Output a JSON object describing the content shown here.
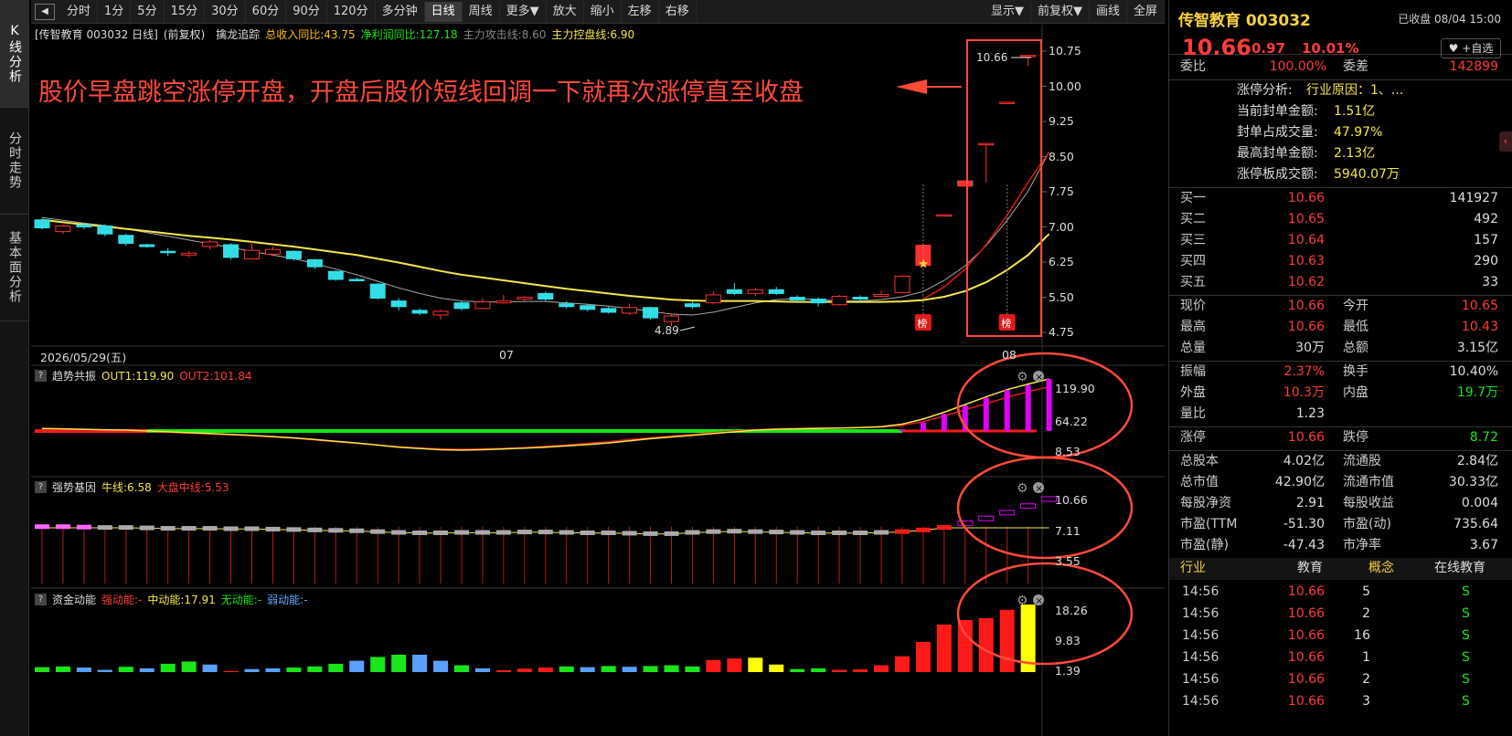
{
  "toolbar": {
    "periods": [
      "分时",
      "1分",
      "5分",
      "15分",
      "30分",
      "60分",
      "90分",
      "120分",
      "多分钟",
      "日线",
      "周线",
      "更多▼",
      "放大",
      "缩小",
      "左移",
      "右移"
    ],
    "active": "日线",
    "right": [
      "显示▼",
      "前复权▼",
      "画线",
      "全屏"
    ]
  },
  "left_tabs": [
    "K线分析",
    "分时走势",
    "基本面分析"
  ],
  "main_panel": {
    "title": "[传智教育 003032 日线]",
    "adjust": "(前复权)",
    "indicator_name": "擒龙追踪",
    "ind_parts": [
      {
        "text": "总收入同比:43.75",
        "color": "#ffc000"
      },
      {
        "text": "净利润同比:127.18",
        "color": "#19e619"
      },
      {
        "text": "主力攻击线:8.60",
        "color": "#888888"
      },
      {
        "text": "主力控盘线:6.90",
        "color": "#f5e64a"
      }
    ],
    "annotation": "股价早盘跳空涨停开盘，开盘后股价短线回调一下就再次涨停直至收盘",
    "y_labels": [
      "10.75",
      "10.00",
      "9.25",
      "8.50",
      "7.75",
      "7.00",
      "6.25",
      "5.50",
      "4.75"
    ],
    "date_labels": [
      "2026/05/29(五)",
      "07",
      "08"
    ],
    "high_label": "10.66",
    "low_label": "4.89",
    "badge": "榜"
  },
  "sub1": {
    "name": "趋势共振",
    "out1": "OUT1:119.90",
    "out2": "OUT2:101.84",
    "y_labels": [
      "119.90",
      "64.22",
      "8.53"
    ]
  },
  "sub2": {
    "name": "强势基因",
    "bull": "牛线:6.58",
    "market": "大盘中线:5.53",
    "y_labels": [
      "10.66",
      "7.11",
      "3.55"
    ]
  },
  "sub3": {
    "name": "资金动能",
    "strong": "强动能:-",
    "mid": "中动能:17.91",
    "none": "无动能:-",
    "weak": "弱动能:-",
    "y_labels": [
      "18.26",
      "9.83",
      "1.39"
    ]
  },
  "chart_data": {
    "type": "candlestick",
    "symbol": "传智教育 003032",
    "period": "日线",
    "ylim": [
      4.6,
      10.9
    ],
    "candles": [
      {
        "o": 7.15,
        "c": 6.98,
        "h": 7.18,
        "l": 6.95
      },
      {
        "o": 6.9,
        "c": 7.02,
        "h": 7.05,
        "l": 6.85
      },
      {
        "o": 7.04,
        "c": 7.0,
        "h": 7.08,
        "l": 6.95
      },
      {
        "o": 7.02,
        "c": 6.85,
        "h": 7.05,
        "l": 6.8
      },
      {
        "o": 6.82,
        "c": 6.65,
        "h": 6.85,
        "l": 6.6
      },
      {
        "o": 6.62,
        "c": 6.58,
        "h": 6.64,
        "l": 6.55
      },
      {
        "o": 6.48,
        "c": 6.45,
        "h": 6.55,
        "l": 6.38
      },
      {
        "o": 6.4,
        "c": 6.44,
        "h": 6.48,
        "l": 6.35
      },
      {
        "o": 6.58,
        "c": 6.68,
        "h": 6.72,
        "l": 6.52
      },
      {
        "o": 6.62,
        "c": 6.35,
        "h": 6.65,
        "l": 6.3
      },
      {
        "o": 6.32,
        "c": 6.5,
        "h": 6.68,
        "l": 6.3
      },
      {
        "o": 6.42,
        "c": 6.52,
        "h": 6.58,
        "l": 6.38
      },
      {
        "o": 6.48,
        "c": 6.32,
        "h": 6.5,
        "l": 6.28
      },
      {
        "o": 6.3,
        "c": 6.15,
        "h": 6.32,
        "l": 6.1
      },
      {
        "o": 6.05,
        "c": 5.88,
        "h": 6.08,
        "l": 5.85
      },
      {
        "o": 5.88,
        "c": 5.86,
        "h": 5.92,
        "l": 5.84
      },
      {
        "o": 5.78,
        "c": 5.48,
        "h": 5.8,
        "l": 5.45
      },
      {
        "o": 5.42,
        "c": 5.3,
        "h": 5.48,
        "l": 5.22
      },
      {
        "o": 5.22,
        "c": 5.16,
        "h": 5.26,
        "l": 5.12
      },
      {
        "o": 5.12,
        "c": 5.2,
        "h": 5.24,
        "l": 5.02
      },
      {
        "o": 5.38,
        "c": 5.26,
        "h": 5.42,
        "l": 5.22
      },
      {
        "o": 5.26,
        "c": 5.4,
        "h": 5.48,
        "l": 5.24
      },
      {
        "o": 5.38,
        "c": 5.42,
        "h": 5.55,
        "l": 5.36
      },
      {
        "o": 5.46,
        "c": 5.5,
        "h": 5.52,
        "l": 5.42
      },
      {
        "o": 5.58,
        "c": 5.46,
        "h": 5.62,
        "l": 5.42
      },
      {
        "o": 5.36,
        "c": 5.3,
        "h": 5.42,
        "l": 5.26
      },
      {
        "o": 5.32,
        "c": 5.24,
        "h": 5.36,
        "l": 5.2
      },
      {
        "o": 5.26,
        "c": 5.18,
        "h": 5.3,
        "l": 5.15
      },
      {
        "o": 5.16,
        "c": 5.28,
        "h": 5.36,
        "l": 5.12
      },
      {
        "o": 5.28,
        "c": 5.06,
        "h": 5.3,
        "l": 5.02
      },
      {
        "o": 4.98,
        "c": 5.1,
        "h": 5.14,
        "l": 4.89
      },
      {
        "o": 5.36,
        "c": 5.3,
        "h": 5.42,
        "l": 5.26
      },
      {
        "o": 5.38,
        "c": 5.55,
        "h": 5.62,
        "l": 5.35
      },
      {
        "o": 5.66,
        "c": 5.58,
        "h": 5.8,
        "l": 5.55
      },
      {
        "o": 5.58,
        "c": 5.66,
        "h": 5.7,
        "l": 5.52
      },
      {
        "o": 5.66,
        "c": 5.58,
        "h": 5.72,
        "l": 5.55
      },
      {
        "o": 5.5,
        "c": 5.44,
        "h": 5.54,
        "l": 5.4
      },
      {
        "o": 5.46,
        "c": 5.38,
        "h": 5.5,
        "l": 5.3
      },
      {
        "o": 5.34,
        "c": 5.52,
        "h": 5.55,
        "l": 5.32
      },
      {
        "o": 5.5,
        "c": 5.46,
        "h": 5.54,
        "l": 5.4
      },
      {
        "o": 5.52,
        "c": 5.56,
        "h": 5.64,
        "l": 5.5
      },
      {
        "o": 5.6,
        "c": 5.95,
        "h": 5.98,
        "l": 5.58
      },
      {
        "o": 6.18,
        "c": 6.6,
        "h": 6.62,
        "l": 6.18
      },
      {
        "o": 7.26,
        "c": 7.26,
        "h": 7.26,
        "l": 7.26
      },
      {
        "o": 7.98,
        "c": 7.88,
        "h": 7.99,
        "l": 7.86
      },
      {
        "o": 8.78,
        "c": 8.78,
        "h": 8.78,
        "l": 7.95
      },
      {
        "o": 9.66,
        "c": 9.66,
        "h": 9.66,
        "l": 9.66
      },
      {
        "o": 10.65,
        "c": 10.66,
        "h": 10.66,
        "l": 10.43
      }
    ],
    "ma_yellow": [
      7.15,
      7.1,
      7.05,
      7.01,
      6.96,
      6.91,
      6.86,
      6.81,
      6.77,
      6.73,
      6.68,
      6.63,
      6.58,
      6.52,
      6.46,
      6.4,
      6.32,
      6.24,
      6.15,
      6.06,
      5.98,
      5.92,
      5.86,
      5.8,
      5.74,
      5.68,
      5.63,
      5.58,
      5.53,
      5.49,
      5.45,
      5.43,
      5.42,
      5.42,
      5.42,
      5.41,
      5.4,
      5.4,
      5.4,
      5.4,
      5.4,
      5.41,
      5.44,
      5.51,
      5.63,
      5.82,
      6.08,
      6.4,
      6.85
    ],
    "ma_grey": [
      7.2,
      7.14,
      7.08,
      7.03,
      6.96,
      6.88,
      6.8,
      6.72,
      6.64,
      6.56,
      6.48,
      6.4,
      6.32,
      6.22,
      6.1,
      5.98,
      5.84,
      5.7,
      5.58,
      5.48,
      5.42,
      5.4,
      5.4,
      5.41,
      5.41,
      5.38,
      5.35,
      5.31,
      5.26,
      5.2,
      5.14,
      5.12,
      5.18,
      5.28,
      5.38,
      5.45,
      5.47,
      5.45,
      5.42,
      5.42,
      5.45,
      5.51,
      5.62,
      5.86,
      6.17,
      6.6,
      7.14,
      7.76,
      8.6
    ],
    "volume_proxy_sub1": {
      "out1": [
        4,
        3,
        2,
        1,
        0,
        -2,
        -4,
        -6,
        -8,
        -10,
        -12,
        -15,
        -18,
        -22,
        -26,
        -30,
        -35,
        -40,
        -43,
        -46,
        -47,
        -46,
        -44,
        -42,
        -40,
        -37,
        -34,
        -30,
        -25,
        -20,
        -16,
        -12,
        -8,
        -4,
        0,
        2,
        3,
        4,
        5,
        6,
        8,
        14,
        26,
        42,
        60,
        78,
        95,
        108,
        119.9
      ],
      "out2": [
        2,
        1,
        0,
        0,
        -1,
        -3,
        -5,
        -7,
        -9,
        -11,
        -13,
        -16,
        -19,
        -23,
        -27,
        -31,
        -35,
        -39,
        -42,
        -44,
        -45,
        -44,
        -43,
        -41,
        -38,
        -35,
        -31,
        -27,
        -22,
        -18,
        -14,
        -10,
        -6,
        -2,
        1,
        3,
        4,
        5,
        5,
        6,
        7,
        11,
        20,
        33,
        48,
        62,
        77,
        90,
        101.84
      ],
      "bars": [
        0,
        0,
        0,
        0,
        0,
        0,
        0,
        0,
        0,
        0,
        0,
        0,
        0,
        0,
        0,
        0,
        0,
        0,
        0,
        0,
        0,
        0,
        0,
        0,
        0,
        0,
        0,
        0,
        0,
        0,
        0,
        0,
        0,
        0,
        0,
        0,
        0,
        0,
        0,
        0,
        0,
        2,
        18,
        38,
        58,
        76,
        94,
        106,
        119.9
      ]
    },
    "sub2_blocks": [
      7.3,
      7.3,
      7.25,
      7.2,
      7.2,
      7.15,
      7.1,
      7.1,
      7.1,
      7.05,
      7.05,
      7.0,
      6.95,
      6.9,
      6.85,
      6.8,
      6.7,
      6.6,
      6.55,
      6.55,
      6.6,
      6.6,
      6.6,
      6.65,
      6.65,
      6.6,
      6.55,
      6.55,
      6.5,
      6.45,
      6.45,
      6.6,
      6.7,
      6.75,
      6.7,
      6.65,
      6.6,
      6.55,
      6.55,
      6.55,
      6.6,
      6.7,
      6.9,
      7.2,
      7.7,
      8.3,
      9.0,
      9.8,
      10.66
    ],
    "sub3_bars": [
      {
        "v": 1.5,
        "c": "#19e619"
      },
      {
        "v": 1.2,
        "c": "#5aa0ff"
      },
      {
        "v": 0.6,
        "c": "#5aa0ff"
      },
      {
        "v": 1.4,
        "c": "#19e619"
      },
      {
        "v": 1.0,
        "c": "#5aa0ff"
      },
      {
        "v": 2.2,
        "c": "#19e619"
      },
      {
        "v": 2.8,
        "c": "#19e619"
      },
      {
        "v": 2.0,
        "c": "#5aa0ff"
      },
      {
        "v": 0.3,
        "c": "#ff1a1a"
      },
      {
        "v": 0.8,
        "c": "#5aa0ff"
      },
      {
        "v": 1.0,
        "c": "#5aa0ff"
      },
      {
        "v": 1.2,
        "c": "#19e619"
      },
      {
        "v": 1.5,
        "c": "#19e619"
      },
      {
        "v": 2.2,
        "c": "#19e619"
      },
      {
        "v": 3.0,
        "c": "#5aa0ff"
      },
      {
        "v": 4.0,
        "c": "#19e619"
      },
      {
        "v": 4.6,
        "c": "#19e619"
      },
      {
        "v": 4.6,
        "c": "#5aa0ff"
      },
      {
        "v": 3.0,
        "c": "#5aa0ff"
      },
      {
        "v": 1.8,
        "c": "#19e619"
      },
      {
        "v": 1.0,
        "c": "#5aa0ff"
      },
      {
        "v": 0.5,
        "c": "#ff1a1a"
      },
      {
        "v": 0.9,
        "c": "#ff1a1a"
      },
      {
        "v": 1.2,
        "c": "#ff1a1a"
      },
      {
        "v": 1.5,
        "c": "#19e619"
      },
      {
        "v": 1.3,
        "c": "#5aa0ff"
      },
      {
        "v": 1.6,
        "c": "#19e619"
      },
      {
        "v": 1.4,
        "c": "#5aa0ff"
      },
      {
        "v": 1.6,
        "c": "#19e619"
      },
      {
        "v": 1.8,
        "c": "#19e619"
      },
      {
        "v": 1.5,
        "c": "#19e619"
      },
      {
        "v": 3.2,
        "c": "#ff1a1a"
      },
      {
        "v": 3.6,
        "c": "#ff1a1a"
      },
      {
        "v": 3.8,
        "c": "#ffff00"
      },
      {
        "v": 2.0,
        "c": "#ffff00"
      },
      {
        "v": 0.8,
        "c": "#19e619"
      },
      {
        "v": 1.0,
        "c": "#19e619"
      },
      {
        "v": 0.6,
        "c": "#ff1a1a"
      },
      {
        "v": 0.7,
        "c": "#ff1a1a"
      },
      {
        "v": 1.8,
        "c": "#ff1a1a"
      },
      {
        "v": 4.2,
        "c": "#ff1a1a"
      },
      {
        "v": 8.0,
        "c": "#ff1a1a"
      },
      {
        "v": 12.6,
        "c": "#ff1a1a"
      },
      {
        "v": 13.8,
        "c": "#ff1a1a"
      },
      {
        "v": 14.3,
        "c": "#ff1a1a"
      },
      {
        "v": 16.5,
        "c": "#ff1a1a"
      },
      {
        "v": 17.91,
        "c": "#ffff00"
      }
    ]
  },
  "right_panel": {
    "name": "传智教育 003032",
    "status": "已收盘 08/04 15:00",
    "price": "10.66",
    "change": "0.97",
    "pct": "10.01%",
    "add_label": "+自选",
    "weibi_label": "委比",
    "weibi": "100.00%",
    "weicha_label": "委差",
    "weicha": "142899",
    "zt_rows": [
      {
        "label": "涨停分析:",
        "value": "行业原因：1、..."
      },
      {
        "label": "当前封单金额:",
        "value": "1.51亿"
      },
      {
        "label": "封单占成交量:",
        "value": "47.97%"
      },
      {
        "label": "最高封单金额:",
        "value": "2.13亿"
      },
      {
        "label": "涨停板成交额:",
        "value": "5940.07万"
      }
    ],
    "bids": [
      {
        "label": "买一",
        "price": "10.66",
        "vol": "141927"
      },
      {
        "label": "买二",
        "price": "10.65",
        "vol": "492"
      },
      {
        "label": "买三",
        "price": "10.64",
        "vol": "157"
      },
      {
        "label": "买四",
        "price": "10.63",
        "vol": "290"
      },
      {
        "label": "买五",
        "price": "10.62",
        "vol": "33"
      }
    ],
    "stats": [
      {
        "l1": "现价",
        "v1": "10.66",
        "c1": "#ff3b3b",
        "l2": "今开",
        "v2": "10.65",
        "c2": "#ff3b3b"
      },
      {
        "l1": "最高",
        "v1": "10.66",
        "c1": "#ff3b3b",
        "l2": "最低",
        "v2": "10.43",
        "c2": "#ff3b3b"
      },
      {
        "l1": "总量",
        "v1": "30万",
        "c1": "#dddddd",
        "l2": "总额",
        "v2": "3.15亿",
        "c2": "#dddddd"
      }
    ],
    "stats2": [
      {
        "l1": "振幅",
        "v1": "2.37%",
        "c1": "#ff3b3b",
        "l2": "换手",
        "v2": "10.40%",
        "c2": "#dddddd"
      },
      {
        "l1": "外盘",
        "v1": "10.3万",
        "c1": "#ff3b3b",
        "l2": "内盘",
        "v2": "19.7万",
        "c2": "#19e619"
      },
      {
        "l1": "量比",
        "v1": "1.23",
        "c1": "#dddddd",
        "l2": "",
        "v2": "",
        "c2": "#dddddd"
      }
    ],
    "limits": {
      "l1": "涨停",
      "v1": "10.66",
      "l2": "跌停",
      "v2": "8.72"
    },
    "fund": [
      {
        "l1": "总股本",
        "v1": "4.02亿",
        "l2": "流通股",
        "v2": "2.84亿"
      },
      {
        "l1": "总市值",
        "v1": "42.90亿",
        "l2": "流通市值",
        "v2": "30.33亿"
      },
      {
        "l1": "每股净资",
        "v1": "2.91",
        "l2": "每股收益",
        "v2": "0.004"
      },
      {
        "l1": "市盈(TTM",
        "v1": "-51.30",
        "l2": "市盈(动)",
        "v2": "735.64"
      },
      {
        "l1": "市盈(静)",
        "v1": "-47.43",
        "l2": "市净率",
        "v2": "3.67"
      }
    ],
    "industry": {
      "l1": "行业",
      "v1": "教育",
      "l2": "概念",
      "v2": "在线教育"
    },
    "ticks": [
      {
        "t": "14:56",
        "p": "10.66",
        "v": "5",
        "s": "S"
      },
      {
        "t": "14:56",
        "p": "10.66",
        "v": "2",
        "s": "S"
      },
      {
        "t": "14:56",
        "p": "10.66",
        "v": "16",
        "s": "S"
      },
      {
        "t": "14:56",
        "p": "10.66",
        "v": "1",
        "s": "S"
      },
      {
        "t": "14:56",
        "p": "10.66",
        "v": "2",
        "s": "S"
      },
      {
        "t": "14:56",
        "p": "10.66",
        "v": "3",
        "s": "S"
      }
    ]
  }
}
